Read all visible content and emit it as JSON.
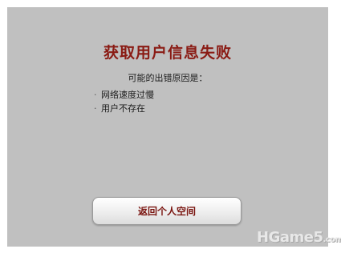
{
  "dialog": {
    "title": "获取用户信息失败",
    "subtitle": "可能的出错原因是：",
    "reasons": [
      "网络速度过慢",
      "用户不存在"
    ],
    "back_button_label": "返回个人空间"
  },
  "watermark": {
    "text": "HGame5",
    "suffix": ".com"
  },
  "colors": {
    "panel_bg": "#c0c0c0",
    "title": "#8a1b14",
    "button_text": "#7a1510"
  }
}
